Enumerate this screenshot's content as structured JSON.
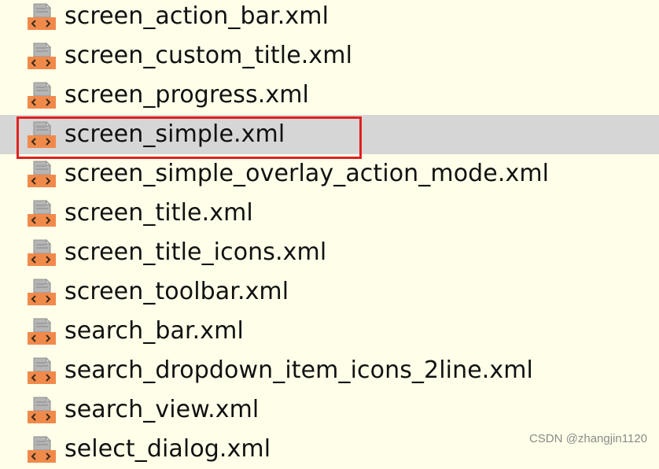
{
  "files": [
    {
      "name": "screen_action_bar.xml",
      "icon": "xml-file-icon",
      "selected": false
    },
    {
      "name": "screen_custom_title.xml",
      "icon": "xml-file-icon",
      "selected": false
    },
    {
      "name": "screen_progress.xml",
      "icon": "xml-file-icon",
      "selected": false
    },
    {
      "name": "screen_simple.xml",
      "icon": "xml-file-icon",
      "selected": true
    },
    {
      "name": "screen_simple_overlay_action_mode.xml",
      "icon": "xml-file-icon",
      "selected": false
    },
    {
      "name": "screen_title.xml",
      "icon": "xml-file-icon",
      "selected": false
    },
    {
      "name": "screen_title_icons.xml",
      "icon": "xml-file-icon",
      "selected": false
    },
    {
      "name": "screen_toolbar.xml",
      "icon": "xml-file-icon",
      "selected": false
    },
    {
      "name": "search_bar.xml",
      "icon": "xml-file-icon",
      "selected": false
    },
    {
      "name": "search_dropdown_item_icons_2line.xml",
      "icon": "xml-file-icon",
      "selected": false
    },
    {
      "name": "search_view.xml",
      "icon": "xml-file-icon",
      "selected": false
    },
    {
      "name": "select_dialog.xml",
      "icon": "xml-file-icon",
      "selected": false
    }
  ],
  "colors": {
    "background": "#ffffe9",
    "selection": "#d6d6d6",
    "highlight_border": "#e02020",
    "icon_orange": "#f08a4b"
  },
  "watermark": "CSDN @zhangjin1120"
}
